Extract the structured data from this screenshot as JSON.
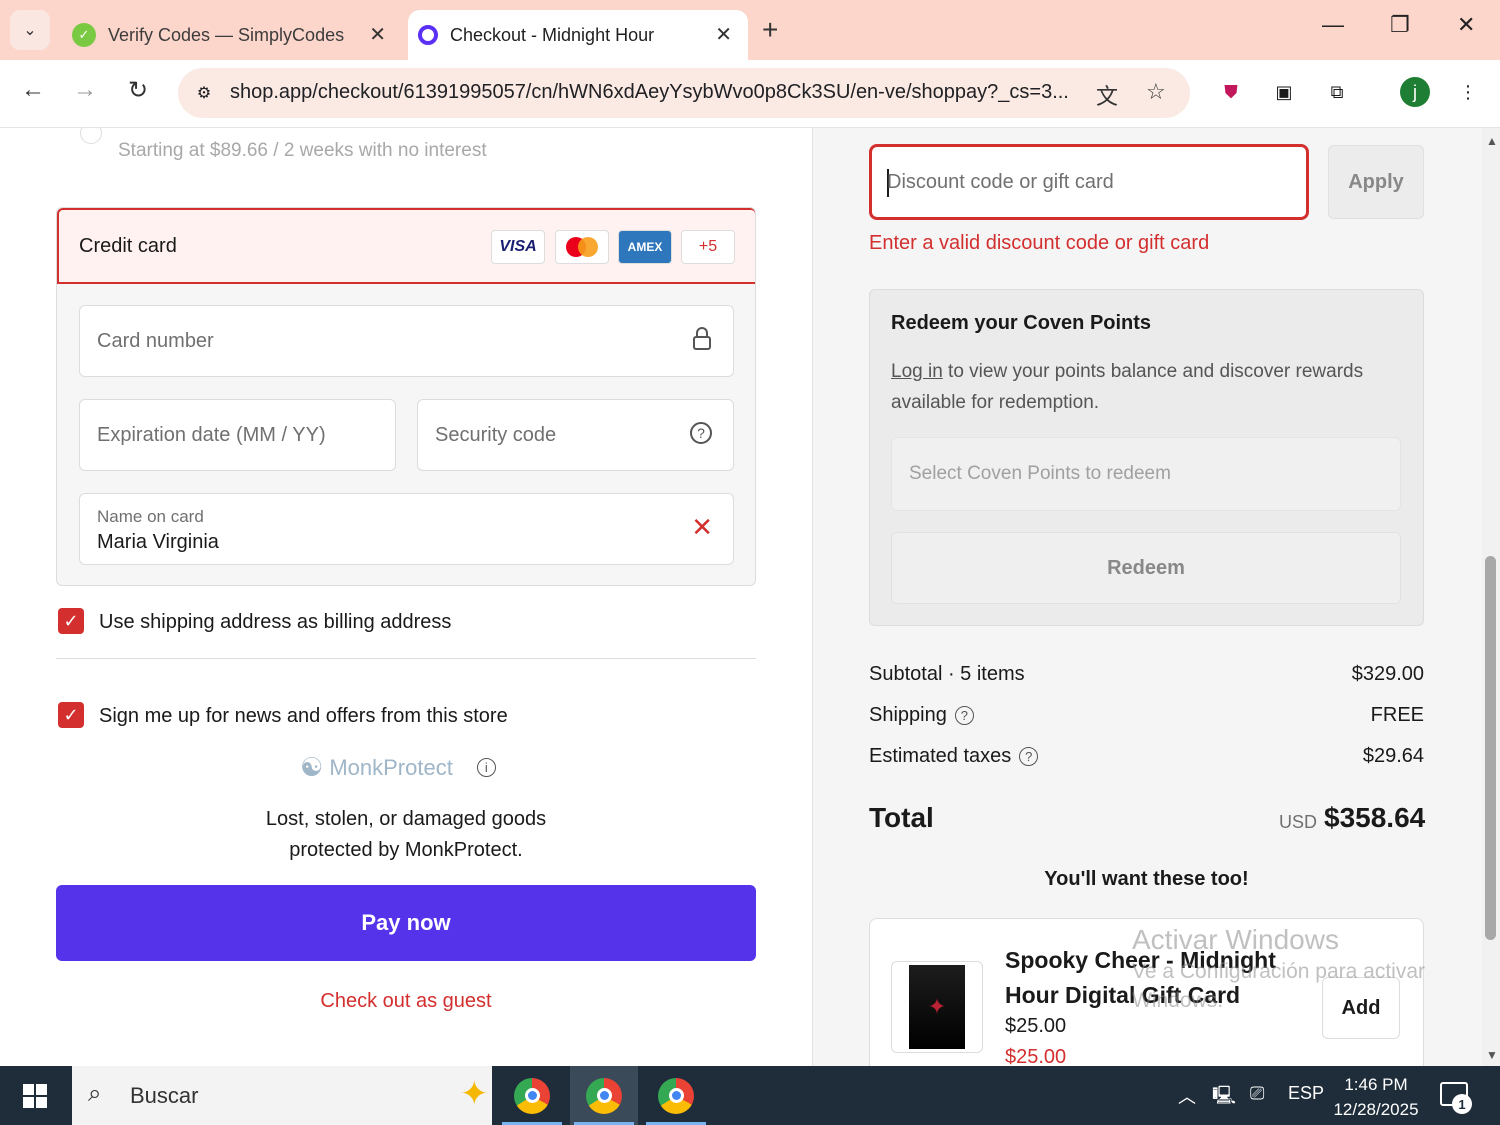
{
  "browser": {
    "tabs": [
      {
        "title": "Verify Codes — SimplyCodes",
        "active": false
      },
      {
        "title": "Checkout - Midnight Hour",
        "active": true
      }
    ],
    "url": "shop.app/checkout/61391995057/cn/hWN6xdAeyYsybWvo0p8Ck3SU/en-ve/shoppay?_cs=3...",
    "profile_initial": "j"
  },
  "payment": {
    "installment_text": "Starting at $89.66 / 2 weeks with no interest",
    "method_label": "Credit card",
    "brands": [
      "VISA",
      "AMEX",
      "+5"
    ],
    "card_number_placeholder": "Card number",
    "expiration_placeholder": "Expiration date (MM / YY)",
    "security_placeholder": "Security code",
    "name_label": "Name on card",
    "name_value": "Maria Virginia",
    "billing_checkbox_label": "Use shipping address as billing address",
    "billing_checked": true,
    "news_checkbox_label": "Sign me up for news and offers from this store",
    "news_checked": true,
    "monk_brand": "MonkProtect",
    "monk_line1": "Lost, stolen, or damaged goods",
    "monk_line2": "protected by MonkProtect.",
    "pay_button": "Pay now",
    "guest_link": "Check out as guest"
  },
  "summary": {
    "discount_placeholder": "Discount code or gift card",
    "apply_button": "Apply",
    "discount_error": "Enter a valid discount code or gift card",
    "points": {
      "title": "Redeem your Coven Points",
      "login_link": "Log in",
      "body": " to view your points balance and discover rewards available for redemption.",
      "select_placeholder": "Select Coven Points to redeem",
      "redeem_button": "Redeem"
    },
    "subtotal_label": "Subtotal · 5 items",
    "subtotal_value": "$329.00",
    "shipping_label": "Shipping",
    "shipping_value": "FREE",
    "taxes_label": "Estimated taxes",
    "taxes_value": "$29.64",
    "total_label": "Total",
    "total_currency": "USD",
    "total_value": "$358.64",
    "upsell_heading": "You'll want these too!",
    "product": {
      "name": "Spooky Cheer - Midnight Hour Digital Gift Card",
      "price": "$25.00",
      "sale_price": "$25.00",
      "add_button": "Add"
    }
  },
  "watermark": {
    "line1": "Activar Windows",
    "line2": "Ve a Configuración para activar",
    "line3": "Windows."
  },
  "taskbar": {
    "search_text": "Buscar",
    "language": "ESP",
    "time": "1:46 PM",
    "date": "12/28/2025",
    "notification_count": "1"
  }
}
